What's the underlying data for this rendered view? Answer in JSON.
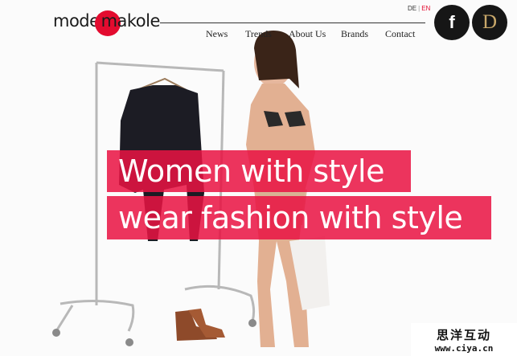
{
  "brand": {
    "logo_word_1": "mode",
    "logo_word_2": "makole",
    "accent_color": "#e30b2f"
  },
  "language": {
    "options": [
      "DE",
      "EN"
    ],
    "separator": "|",
    "active": "EN"
  },
  "nav": {
    "items": [
      {
        "label": "News"
      },
      {
        "label": "Trends"
      },
      {
        "label": "About Us"
      },
      {
        "label": "Brands"
      },
      {
        "label": "Contact"
      }
    ]
  },
  "social": {
    "facebook_glyph": "f",
    "d_glyph": "D",
    "facebook_icon": "facebook-icon",
    "d_icon": "d-logo-icon"
  },
  "hero": {
    "headline_line_1": "Women with style",
    "headline_line_2": "wear fashion with style",
    "band_color": "#e91342"
  },
  "watermark": {
    "chinese": "思洋互动",
    "url": "www.ciya.cn"
  }
}
